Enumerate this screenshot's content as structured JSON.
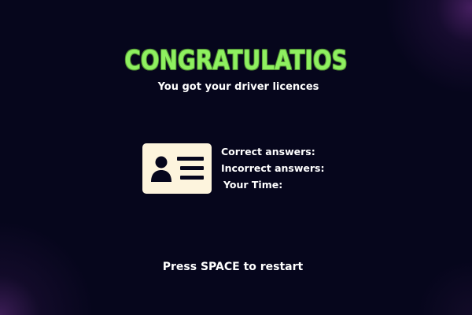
{
  "screen": {
    "title": "CONGRATULATIOS",
    "subtitle": "You got your driver licences",
    "restart_prompt": "Press SPACE to restart"
  },
  "stats": {
    "correct_label": "Correct answers:",
    "incorrect_label": "Incorrect answers:",
    "time_label": "Your Time:"
  },
  "icons": {
    "license": "id-card-icon"
  },
  "colors": {
    "background": "#06061c",
    "title": "#8ef060",
    "text": "#ffffff",
    "card": "#fdf4dd",
    "card_glyph": "#06061c"
  }
}
